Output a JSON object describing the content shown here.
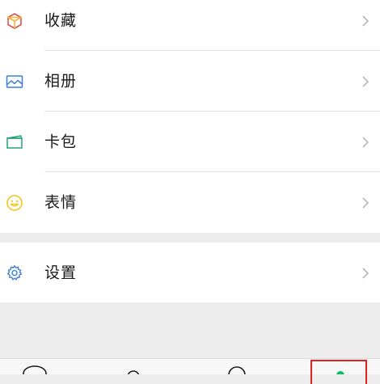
{
  "menu": {
    "favorites": {
      "label": "收藏",
      "icon": "cube-icon"
    },
    "album": {
      "label": "相册",
      "icon": "picture-icon"
    },
    "cards": {
      "label": "卡包",
      "icon": "card-wallet-icon"
    },
    "stickers": {
      "label": "表情",
      "icon": "smiley-icon"
    },
    "settings": {
      "label": "设置",
      "icon": "gear-icon"
    }
  },
  "colors": {
    "background": "#ededed",
    "favorites_icon_stroke": "#d9534f",
    "favorites_icon_fill": "#f3b23a",
    "album_icon": "#3d7fd6",
    "cards_icon": "#27a17a",
    "stickers_icon": "#f5c518",
    "settings_icon": "#3d7fd6",
    "chevron": "#b2b2b2",
    "highlight": "#e02020"
  },
  "tabbar": {
    "tabs": [
      "chat-tab-icon",
      "contacts-tab-icon",
      "discover-tab-icon",
      "me-tab-icon"
    ]
  }
}
